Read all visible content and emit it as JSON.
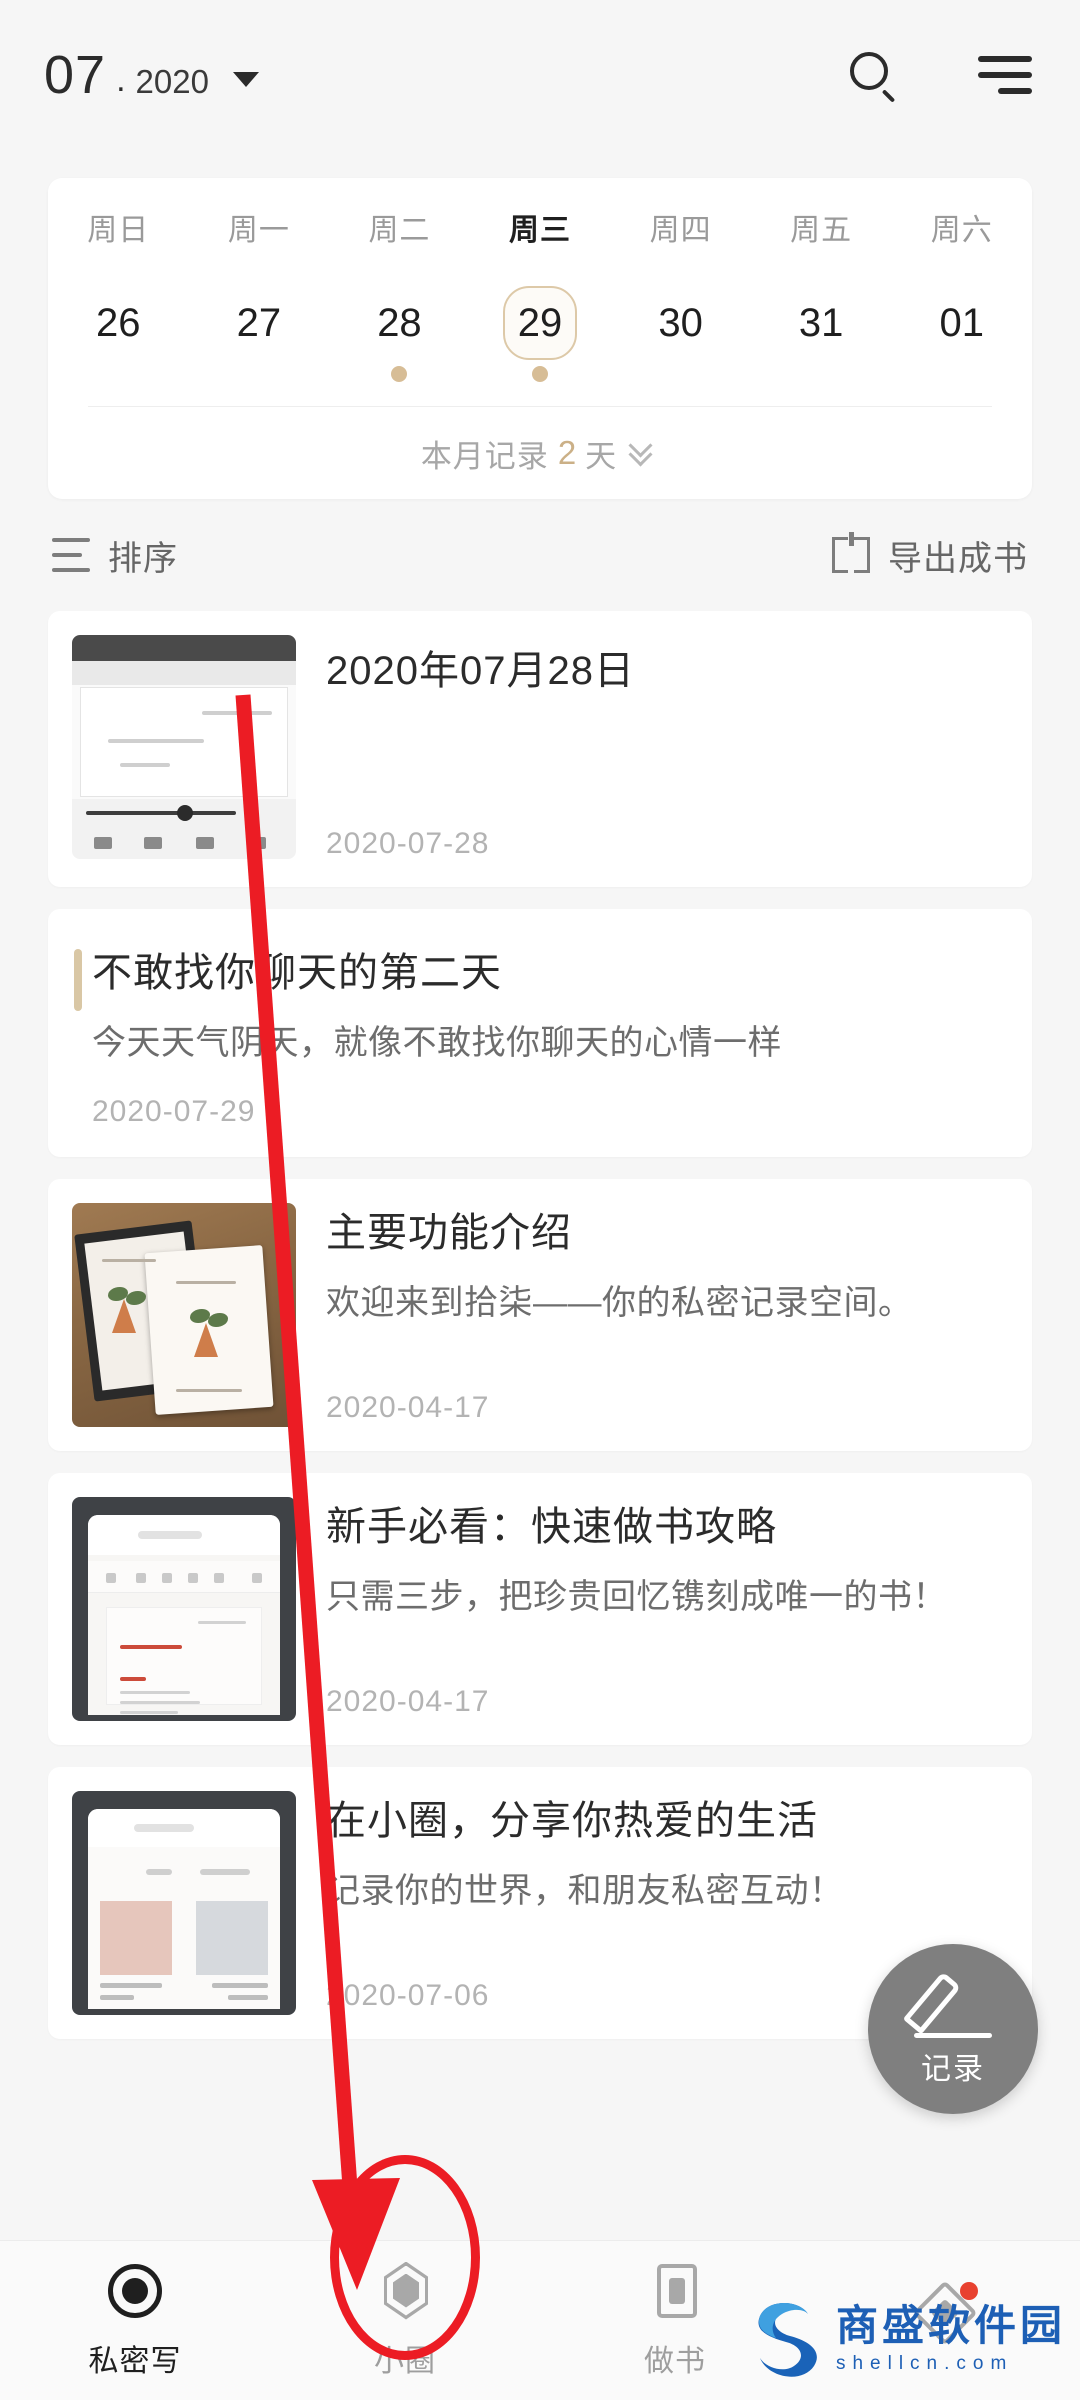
{
  "header": {
    "month": "07",
    "separator": ".",
    "year": "2020",
    "dropdown_icon": "caret-down-icon",
    "search_icon": "search-icon",
    "menu_icon": "hamburger-menu-icon"
  },
  "calendar": {
    "weekdays": [
      "周日",
      "周一",
      "周二",
      "周三",
      "周四",
      "周五",
      "周六"
    ],
    "days": [
      "26",
      "27",
      "28",
      "29",
      "30",
      "31",
      "01"
    ],
    "selected_index": 3,
    "active_weekday_index": 3,
    "record_dot_indexes": [
      2,
      3
    ],
    "dot_color": "#d7bd96",
    "selected_border_color": "#ddc9a8",
    "footer": {
      "prefix": "本月记录",
      "count": "2",
      "suffix": "天",
      "count_color": "#cbb087",
      "expand_icon": "double-chevron-down-icon"
    }
  },
  "toolbar": {
    "sort_label": "排序",
    "sort_icon": "sort-lines-icon",
    "export_label": "导出成书",
    "export_icon": "open-book-icon"
  },
  "entries": [
    {
      "title": "2020年07月28日",
      "desc": "",
      "date": "2020-07-28",
      "thumb": "screenshot-document",
      "accent_bar": false
    },
    {
      "title": "不敢找你聊天的第二天",
      "desc": "今天天气阴天，就像不敢找你聊天的心情一样",
      "date": "2020-07-29",
      "thumb": "",
      "accent_bar": true
    },
    {
      "title": "主要功能介绍",
      "desc": "欢迎来到拾柒——你的私密记录空间。",
      "date": "2020-04-17",
      "thumb": "photo-books-on-wood",
      "accent_bar": false
    },
    {
      "title": "新手必看：快速做书攻略",
      "desc": "只需三步，把珍贵回忆镌刻成唯一的书！",
      "date": "2020-04-17",
      "thumb": "screenshot-phone-editor",
      "accent_bar": false
    },
    {
      "title": "在小圈，分享你热爱的生活",
      "desc": "记录你的世界，和朋友私密互动！",
      "date": "2020-07-06",
      "thumb": "screenshot-phone-feed",
      "accent_bar": false
    }
  ],
  "fab": {
    "label": "记录",
    "icon": "pencil-icon",
    "color": "#7f7f7f"
  },
  "bottom_nav": [
    {
      "label": "私密写",
      "icon": "circle-dot-icon",
      "active": true,
      "badge": false
    },
    {
      "label": "小圈",
      "icon": "hexagon-icon",
      "active": false,
      "badge": false
    },
    {
      "label": "做书",
      "icon": "book-icon",
      "active": false,
      "badge": false
    },
    {
      "label": "",
      "icon": "diamond-icon",
      "active": false,
      "badge": true
    }
  ],
  "annotation": {
    "arrow_color": "#ec1c24",
    "highlight_target": "小圈"
  },
  "watermark": {
    "cn": "商盛软件园",
    "en": "shellcn.com",
    "color": "#1d5fb5"
  }
}
